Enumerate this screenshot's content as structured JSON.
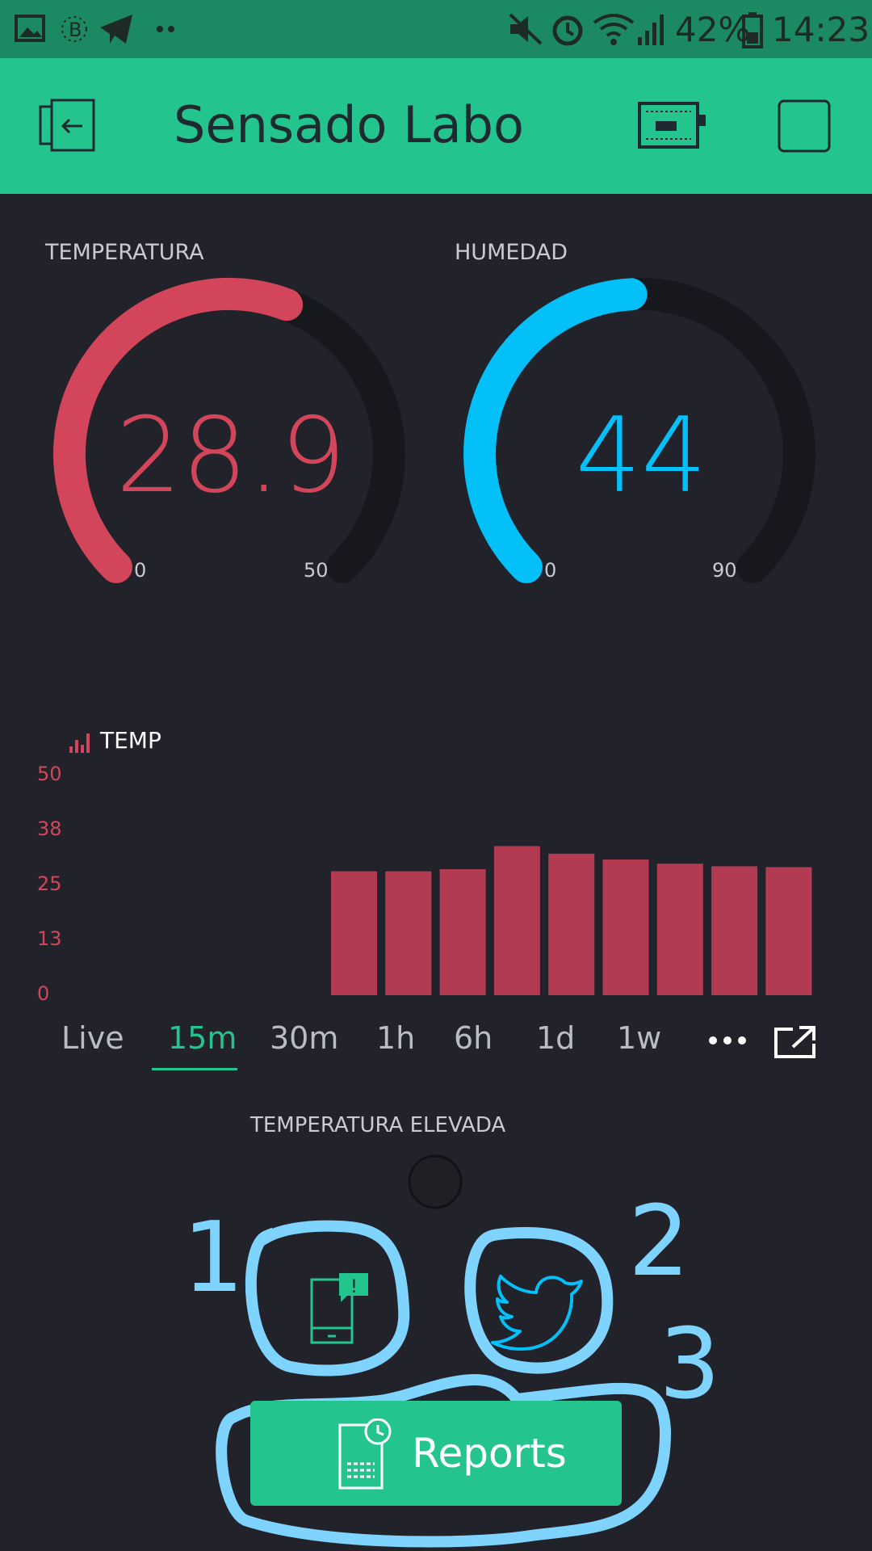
{
  "status_bar": {
    "battery": "42%",
    "time": "14:23",
    "icons": [
      "gallery-icon",
      "bluetooth-b-icon",
      "telegram-icon",
      "more-dots-icon",
      "mute-icon",
      "alarm-icon",
      "wifi-icon",
      "signal-icon",
      "battery-icon"
    ]
  },
  "header": {
    "title": "Sensado Labo",
    "icons": [
      "exit-icon",
      "device-board-icon",
      "stop-square-icon"
    ],
    "color": "#23c48e"
  },
  "gauges": [
    {
      "label": "TEMPERATURA",
      "value": "28.9",
      "min": "0",
      "max": "50",
      "fraction": 0.578,
      "color": "#d3455b"
    },
    {
      "label": "HUMEDAD",
      "value": "44",
      "min": "0",
      "max": "90",
      "fraction": 0.489,
      "color": "#04c0f8"
    }
  ],
  "chart_data": {
    "type": "bar",
    "legend": "TEMP",
    "yticks": [
      "50",
      "38",
      "25",
      "13",
      "0"
    ],
    "ylim": [
      0,
      50
    ],
    "values": [
      29.5,
      29.5,
      30,
      35.5,
      33.7,
      32.3,
      31.3,
      30.7,
      30.5
    ],
    "color": "#b23b52"
  },
  "timeframes": {
    "items": [
      "Live",
      "15m",
      "30m",
      "1h",
      "6h",
      "1d",
      "1w"
    ],
    "active": "15m"
  },
  "alert": {
    "label": "TEMPERATURA ELEVADA"
  },
  "widgets": {
    "icons": [
      "notification-phone-icon",
      "twitter-bird-icon"
    ]
  },
  "annotations": {
    "one": "1",
    "two": "2",
    "three": "3"
  },
  "reports": {
    "label": "Reports"
  }
}
